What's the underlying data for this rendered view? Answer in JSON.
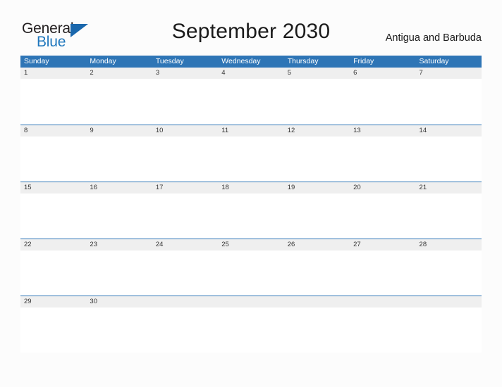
{
  "brand": {
    "name_part1": "General",
    "name_part2": "Blue",
    "triangle_color": "#1b68ad",
    "blue_color": "#1f77bd",
    "icon": "general-blue-logo"
  },
  "header": {
    "title": "September 2030",
    "region": "Antigua and Barbuda"
  },
  "calendar": {
    "month": "September",
    "year": "2030",
    "header_bg": "#2e75b6",
    "day_band_bg": "#efefef",
    "row_border": "#2e75b6",
    "weekdays": [
      "Sunday",
      "Monday",
      "Tuesday",
      "Wednesday",
      "Thursday",
      "Friday",
      "Saturday"
    ],
    "weeks": [
      [
        "1",
        "2",
        "3",
        "4",
        "5",
        "6",
        "7"
      ],
      [
        "8",
        "9",
        "10",
        "11",
        "12",
        "13",
        "14"
      ],
      [
        "15",
        "16",
        "17",
        "18",
        "19",
        "20",
        "21"
      ],
      [
        "22",
        "23",
        "24",
        "25",
        "26",
        "27",
        "28"
      ],
      [
        "29",
        "30",
        "",
        "",
        "",
        "",
        ""
      ]
    ]
  }
}
